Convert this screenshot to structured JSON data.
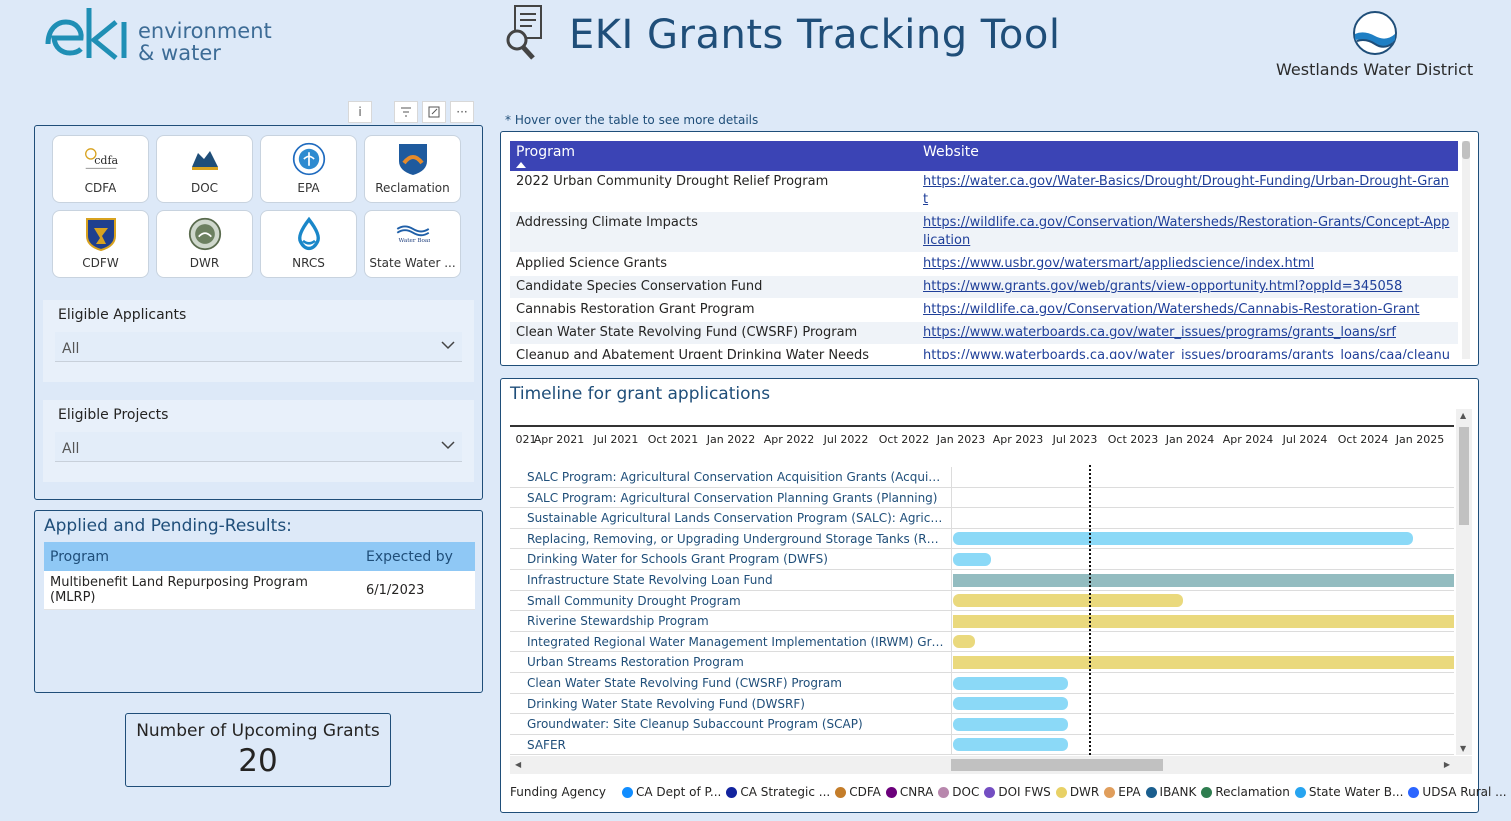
{
  "header": {
    "brand_name": "environment",
    "brand_name2": "& water",
    "title": "EKI Grants Tracking Tool",
    "partner": "Westlands Water District"
  },
  "visual_header": {
    "info": "i",
    "filter": "filter-icon",
    "focus": "focus-mode-icon",
    "more": "···"
  },
  "agencies": [
    {
      "label": "CDFA",
      "icon": "cdfa-logo-icon"
    },
    {
      "label": "DOC",
      "icon": "doc-logo-icon"
    },
    {
      "label": "EPA",
      "icon": "epa-logo-icon"
    },
    {
      "label": "Reclamation",
      "icon": "reclamation-logo-icon"
    },
    {
      "label": "CDFW",
      "icon": "cdfw-logo-icon"
    },
    {
      "label": "DWR",
      "icon": "dwr-logo-icon"
    },
    {
      "label": "NRCS",
      "icon": "nrcs-logo-icon"
    },
    {
      "label": "State Water ...",
      "icon": "water-boards-logo-icon"
    }
  ],
  "filters": {
    "applicants": {
      "title": "Eligible Applicants",
      "value": "All"
    },
    "projects": {
      "title": "Eligible Projects",
      "value": "All"
    }
  },
  "applied": {
    "title": "Applied and Pending-Results:",
    "columns": [
      "Program",
      "Expected by"
    ],
    "rows": [
      [
        "Multibenefit Land Repurposing Program (MLRP)",
        "6/1/2023"
      ]
    ]
  },
  "card": {
    "label": "Number of Upcoming Grants",
    "value": "20"
  },
  "hover_note": "* Hover over the table to see more details",
  "programs": {
    "columns": [
      "Program",
      "Website"
    ],
    "rows": [
      [
        "2022 Urban Community Drought Relief Program",
        "https://water.ca.gov/Water-Basics/Drought/Drought-Funding/Urban-Drought-Grant"
      ],
      [
        "Addressing Climate Impacts",
        "https://wildlife.ca.gov/Conservation/Watersheds/Restoration-Grants/Concept-Application"
      ],
      [
        "Applied Science Grants",
        "https://www.usbr.gov/watersmart/appliedscience/index.html"
      ],
      [
        "Candidate Species Conservation Fund",
        "https://www.grants.gov/web/grants/view-opportunity.html?oppId=345058"
      ],
      [
        "Cannabis Restoration Grant Program",
        "https://wildlife.ca.gov/Conservation/Watersheds/Cannabis-Restoration-Grant"
      ],
      [
        "Clean Water State Revolving Fund (CWSRF) Program",
        "https://www.waterboards.ca.gov/water_issues/programs/grants_loans/srf"
      ],
      [
        "Cleanup and Abatement Urgent Drinking Water Needs",
        "https://www.waterboards.ca.gov/water_issues/programs/grants_loans/caa/cleanup_and_abatement.html"
      ]
    ]
  },
  "timeline": {
    "title": "Timeline for grant applications",
    "ticks": [
      "021",
      "Apr 2021",
      "Jul 2021",
      "Oct 2021",
      "Jan 2022",
      "Apr 2022",
      "Jul 2022",
      "Oct 2022",
      "Jan 2023",
      "Apr 2023",
      "Jul 2023",
      "Oct 2023",
      "Jan 2024",
      "Apr 2024",
      "Jul 2024",
      "Oct 2024",
      "Jan 2025"
    ],
    "today": "2023-06-01",
    "rows": [
      {
        "label": "SALC Program: Agricultural Conservation Acquisition Grants (Acquisiti...",
        "start": null,
        "end": null,
        "agency": "CA Strategic ..."
      },
      {
        "label": "SALC Program: Agricultural Conservation Planning Grants (Planning)",
        "start": null,
        "end": null,
        "agency": "CA Strategic ..."
      },
      {
        "label": "Sustainable Agricultural Lands Conservation Program (SALC): Agricult...",
        "start": null,
        "end": null,
        "agency": "CA Strategic ..."
      },
      {
        "label": "Replacing, Removing, or Upgrading Underground Storage Tanks (RUST)",
        "start": "2023-01-01",
        "end": "2025-01-01",
        "agency": "State Water B..."
      },
      {
        "label": "Drinking Water for Schools Grant Program (DWFS)",
        "start": "2023-01-01",
        "end": "2023-03-01",
        "agency": "State Water B..."
      },
      {
        "label": "Infrastructure State Revolving Loan Fund",
        "start": "2023-01-01",
        "end": "2025-04-01",
        "agency": "IBANK"
      },
      {
        "label": "Small Community Drought Program",
        "start": "2023-01-01",
        "end": "2024-01-01",
        "agency": "DWR"
      },
      {
        "label": "Riverine Stewardship Program",
        "start": "2023-01-01",
        "end": "2025-04-01",
        "agency": "DWR"
      },
      {
        "label": "Integrated Regional Water Management Implementation (IRWM) Grant",
        "start": "2023-01-01",
        "end": "2023-02-05",
        "agency": "DWR"
      },
      {
        "label": "Urban Streams Restoration Program",
        "start": "2023-01-01",
        "end": "2025-04-01",
        "agency": "DWR"
      },
      {
        "label": "Clean Water State Revolving Fund (CWSRF) Program",
        "start": "2023-01-01",
        "end": "2023-07-01",
        "agency": "State Water B..."
      },
      {
        "label": "Drinking Water State Revolving Fund (DWSRF)",
        "start": "2023-01-01",
        "end": "2023-07-01",
        "agency": "State Water B..."
      },
      {
        "label": "Groundwater: Site Cleanup Subaccount Program (SCAP)",
        "start": "2023-01-01",
        "end": "2023-07-01",
        "agency": "State Water B..."
      },
      {
        "label": "SAFER",
        "start": "2023-01-01",
        "end": "2023-07-01",
        "agency": "State Water B..."
      }
    ]
  },
  "legend": {
    "title": "Funding Agency",
    "items": [
      {
        "label": "CA Dept of P...",
        "color": "#118dff"
      },
      {
        "label": "CA Strategic ...",
        "color": "#12239e"
      },
      {
        "label": "CDFA",
        "color": "#c47d2a"
      },
      {
        "label": "CNRA",
        "color": "#6b007b"
      },
      {
        "label": "DOC",
        "color": "#b887ad"
      },
      {
        "label": "DOI FWS",
        "color": "#744ec2"
      },
      {
        "label": "DWR",
        "color": "#e8d166"
      },
      {
        "label": "EPA",
        "color": "#e09e5c"
      },
      {
        "label": "IBANK",
        "color": "#1a5e8e"
      },
      {
        "label": "Reclamation",
        "color": "#2e7d4f"
      },
      {
        "label": "State Water B...",
        "color": "#27a4f0"
      },
      {
        "label": "UDSA Rural ...",
        "color": "#2b65ff"
      }
    ]
  },
  "bar_colors": {
    "State Water B...": "#8bd9f7",
    "IBANK": "#93bcc0",
    "DWR": "#ead97d",
    "CA Strategic ...": "#12239e"
  }
}
